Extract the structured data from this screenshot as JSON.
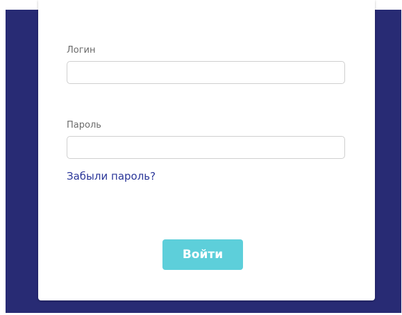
{
  "login_form": {
    "login_label": "Логин",
    "login_value": "",
    "password_label": "Пароль",
    "password_value": "",
    "forgot_password_link": "Забыли пароль?",
    "submit_label": "Войти"
  },
  "colors": {
    "backdrop": "#282b74",
    "card": "#ffffff",
    "label_text": "#6a6a6a",
    "input_border": "#cfcfcf",
    "link": "#2a3699",
    "button": "#5dcfda",
    "button_text": "#ffffff"
  }
}
